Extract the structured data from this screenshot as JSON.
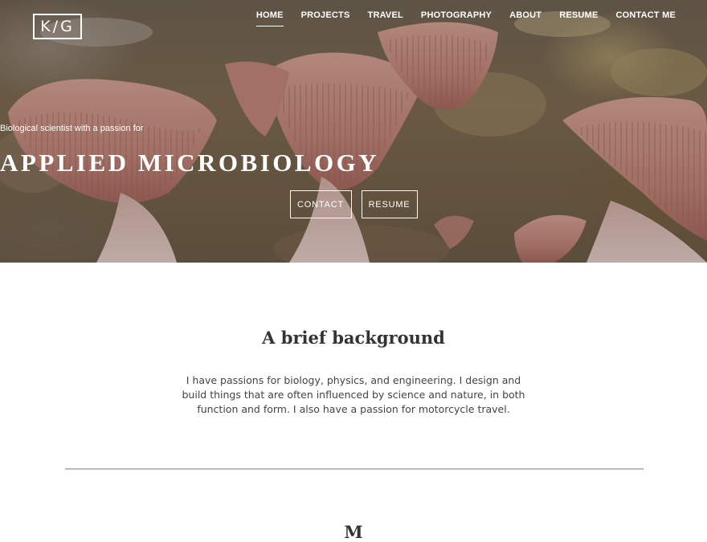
{
  "header": {
    "logo_text": "K/G",
    "nav": [
      {
        "label": "HOME",
        "active": true
      },
      {
        "label": "PROJECTS",
        "active": false
      },
      {
        "label": "TRAVEL",
        "active": false
      },
      {
        "label": "PHOTOGRAPHY",
        "active": false
      },
      {
        "label": "ABOUT",
        "active": false
      },
      {
        "label": "RESUME",
        "active": false
      },
      {
        "label": "CONTACT ME",
        "active": false
      }
    ]
  },
  "hero": {
    "tagline": "Biological scientist with a passion for",
    "headline": "APPLIED MICROBIOLOGY",
    "buttons": {
      "contact": "CONTACT",
      "resume": "RESUME"
    },
    "image_subject": "pink oyster mushrooms"
  },
  "about": {
    "title": "A brief background",
    "text": "I have passions for biology, physics, and engineering. I design and build things that are often influenced by science and nature, in both function and form. I also have a passion for motorcycle travel.",
    "next_title_partial": "M"
  },
  "colors": {
    "hero_overlay": "#2a1e1e",
    "mushroom_pink": "#c98d80",
    "divider": "#b8b8b8",
    "text": "#333333"
  }
}
